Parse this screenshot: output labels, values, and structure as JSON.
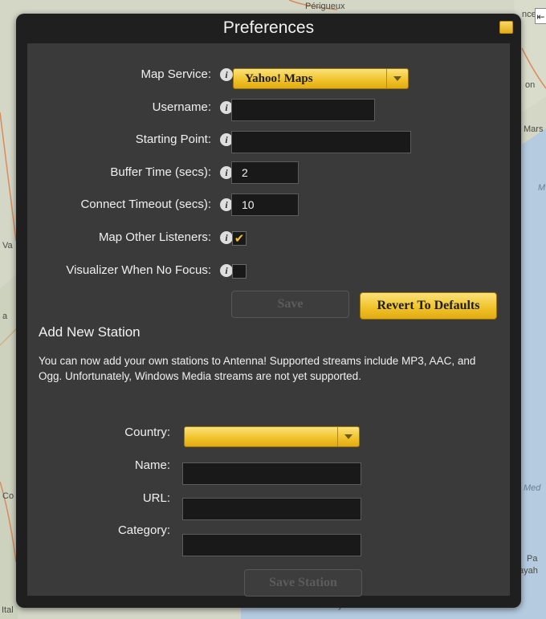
{
  "map": {
    "labels": {
      "perigueux": "Périgueux",
      "marseille": "Mars",
      "val": "Va",
      "a": "a",
      "co": "Co",
      "med": "Med",
      "pa": "Pa",
      "ayah": "ayah",
      "ital": "Ital",
      "sattiyah": "as-Sattiyah",
      "cannes": "nce",
      "on": "on",
      "m": "M"
    },
    "corner_button": "⇤"
  },
  "window": {
    "title": "Preferences"
  },
  "form": {
    "map_service": {
      "label": "Map Service:",
      "value": "Yahoo! Maps"
    },
    "username": {
      "label": "Username:",
      "value": ""
    },
    "starting_point": {
      "label": "Starting Point:",
      "value": ""
    },
    "buffer_time": {
      "label": "Buffer Time (secs):",
      "value": "2"
    },
    "connect_timeout": {
      "label": "Connect Timeout (secs):",
      "value": "10"
    },
    "map_other_listeners": {
      "label": "Map Other Listeners:",
      "checked": true,
      "mark": "✔"
    },
    "visualizer_no_focus": {
      "label": "Visualizer When No Focus:",
      "checked": false,
      "mark": ""
    },
    "info_glyph": "i",
    "save_label": "Save",
    "revert_label": "Revert To Defaults"
  },
  "station": {
    "heading": "Add New Station",
    "description": "You can now add your own stations to Antenna! Supported streams include MP3, AAC, and Ogg. Unfortunately, Windows Media streams are not yet supported.",
    "country": {
      "label": "Country:",
      "value": ""
    },
    "name": {
      "label": "Name:",
      "value": ""
    },
    "url": {
      "label": "URL:",
      "value": ""
    },
    "category": {
      "label": "Category:",
      "value": ""
    },
    "save_station_label": "Save Station"
  },
  "colors": {
    "accent_gold": "#efc127",
    "panel": "#3a3a3a",
    "window_frame": "#1f1f1f"
  }
}
